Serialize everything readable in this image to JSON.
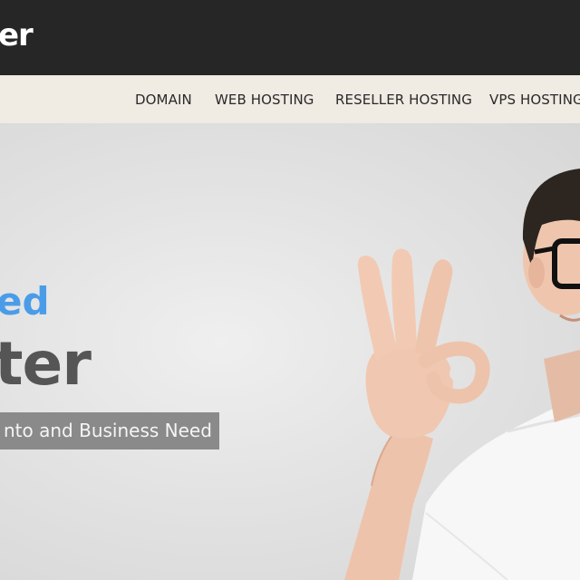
{
  "header": {
    "logo_text": "er"
  },
  "nav": {
    "items": [
      {
        "label": "DOMAIN"
      },
      {
        "label": "WEB HOSTING"
      },
      {
        "label": "RESELLER HOSTING"
      },
      {
        "label": "VPS HOSTING"
      }
    ]
  },
  "hero": {
    "line1": "ed",
    "line2": "ter",
    "tagline": "nto and Business Need"
  },
  "colors": {
    "topbar": "#262626",
    "navbar": "#f0ebe3",
    "accent_blue": "#4b9ce8",
    "headline_gray": "#555555",
    "tagline_bg": "#8a8a8a"
  }
}
